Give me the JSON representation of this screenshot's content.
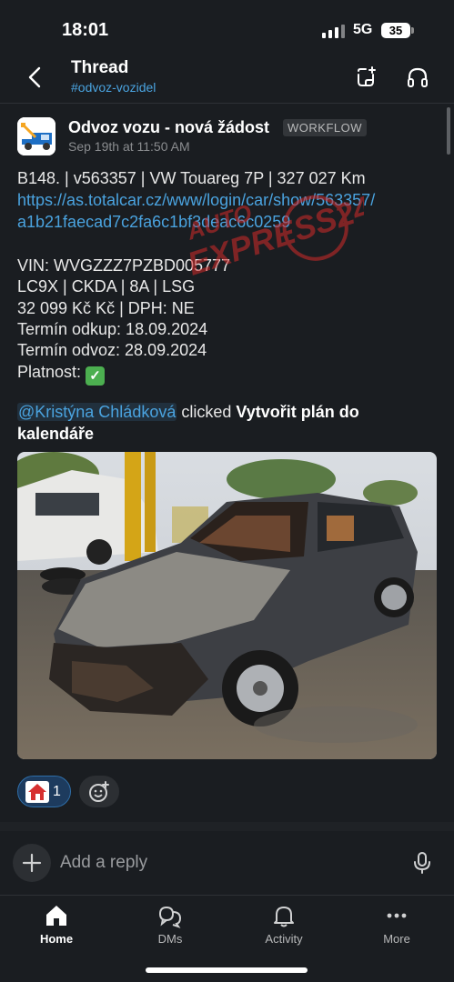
{
  "status_bar": {
    "time": "18:01",
    "network": "5G",
    "battery": "35"
  },
  "header": {
    "title": "Thread",
    "channel": "#odvoz-vozidel"
  },
  "message": {
    "author": "Odvoz vozu - nová žádost",
    "badge": "WORKFLOW",
    "timestamp": "Sep 19th at 11:50 AM",
    "line1": "B148. | v563357 |  VW Touareg 7P | 327 027 Km",
    "link_line1": "https://as.totalcar.cz/www/login/car/show/563357/",
    "link_line2": "a1b21faecad7c2fa6c1bf3deac6c0259",
    "vin": "VIN: WVGZZZ7PZBD005777",
    "codes": "LC9X | CKDA | 8A | LSG",
    "price": "32 099 Kč Kč | DPH: NE",
    "buy_date": "Termín odkup: 18.09.2024",
    "pickup_date": "Termín odvoz: 28.09.2024",
    "validity": "Platnost: ",
    "mention": "@Kristýna Chládková",
    "clicked": " clicked ",
    "action_part1": "Vytvořit plán do",
    "action_part2": "kalendáře"
  },
  "watermark": {
    "line1": "AUTO",
    "line2": "EXPRESS24"
  },
  "reactions": [
    {
      "icon": "house-icon",
      "count": "1"
    }
  ],
  "reply": {
    "placeholder": "Add a reply"
  },
  "tabs": [
    {
      "label": "Home",
      "icon": "home-icon",
      "active": true
    },
    {
      "label": "DMs",
      "icon": "dms-icon",
      "active": false
    },
    {
      "label": "Activity",
      "icon": "bell-icon",
      "active": false
    },
    {
      "label": "More",
      "icon": "more-icon",
      "active": false
    }
  ],
  "colors": {
    "background": "#1a1d21",
    "link": "#4aa3df",
    "watermark": "#d32a2a",
    "reaction_bg": "#1d3b5e"
  }
}
